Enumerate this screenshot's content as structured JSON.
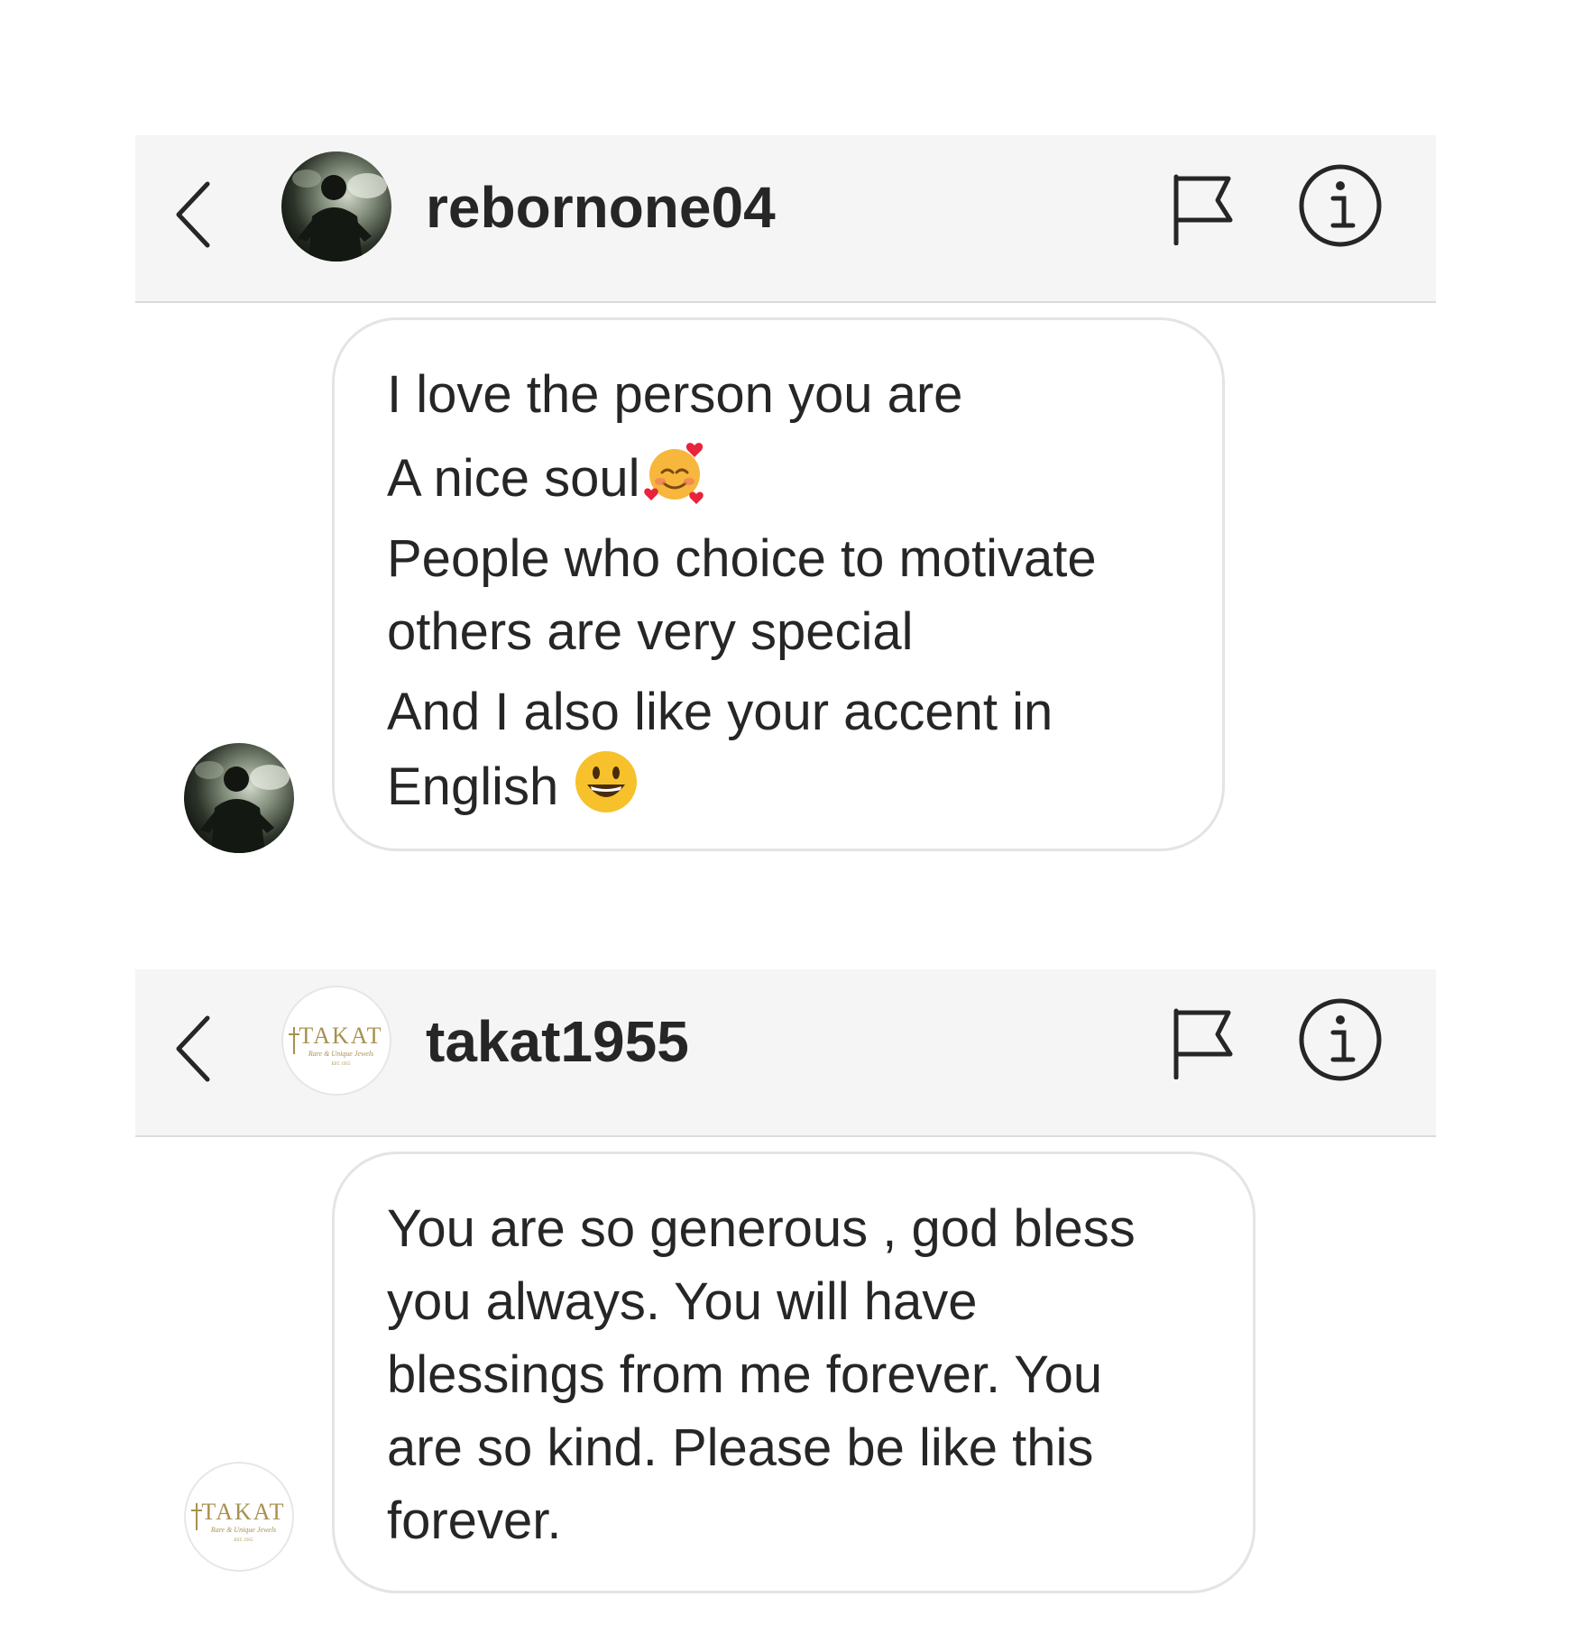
{
  "colors": {
    "header_bg": "#f5f5f5",
    "divider": "#dbdbdb",
    "bubble_border": "#e4e4e4",
    "text": "#262626",
    "logo_gold": "#a8914f"
  },
  "conversations": [
    {
      "header": {
        "back_icon": "chevron-left-icon",
        "avatar_icon": "profile-photo-silhouette",
        "username": "rebornone04",
        "flag_icon": "flag-icon",
        "info_icon": "info-icon"
      },
      "message": {
        "lines": [
          "I love the person you are",
          "A nice soul",
          "People who choice to motivate",
          "others are very special",
          "And I also like your accent in",
          "English"
        ],
        "emojis": [
          "smiling-face-with-hearts-emoji",
          "smiling-face-with-open-mouth-emoji"
        ]
      }
    },
    {
      "header": {
        "back_icon": "chevron-left-icon",
        "avatar_icon": "takat-logo",
        "username": "takat1955",
        "flag_icon": "flag-icon",
        "info_icon": "info-icon"
      },
      "logo": {
        "brand": "TAKAT",
        "tagline": "Rare & Unique Jewels",
        "est": "EST. 1955"
      },
      "message": {
        "lines": [
          "You are so generous , god bless",
          "you always. You will have",
          "blessings from me forever. You",
          "are so kind. Please be like this",
          "forever."
        ]
      }
    }
  ]
}
